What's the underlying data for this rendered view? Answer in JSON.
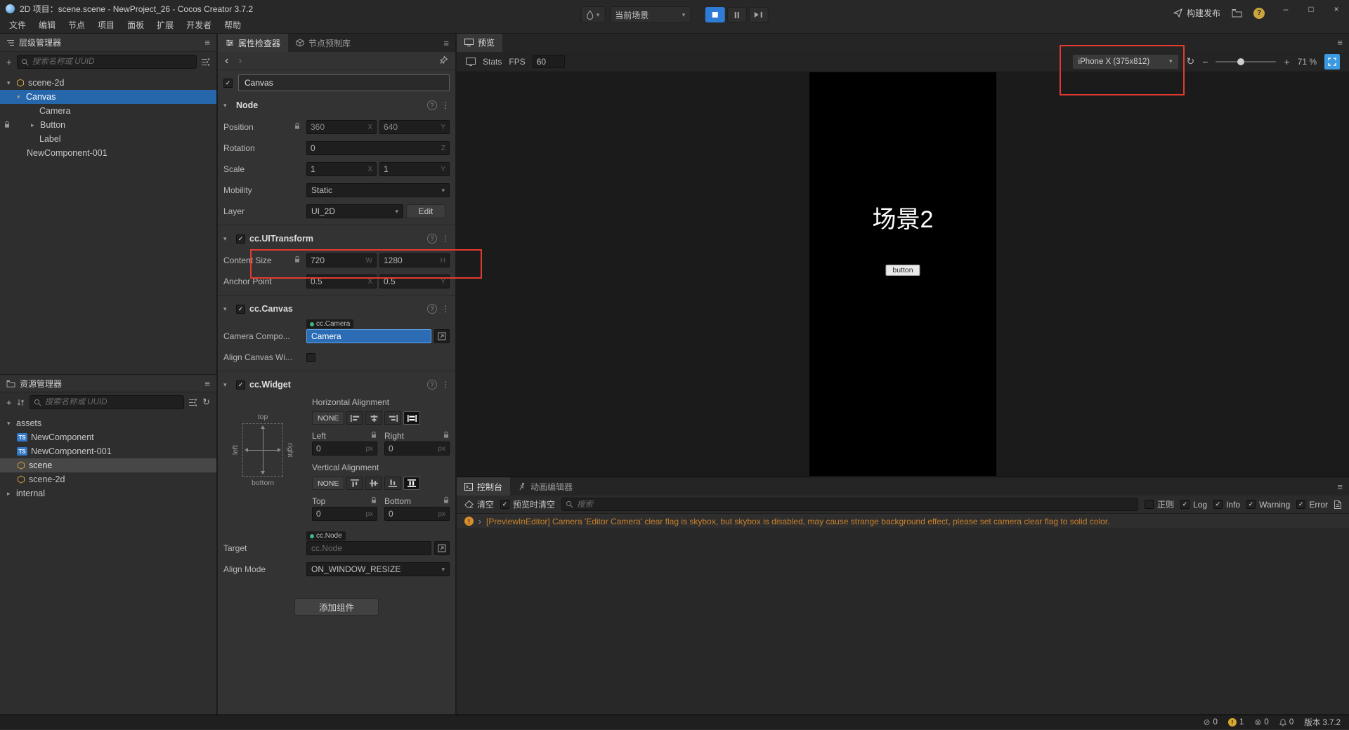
{
  "titlebar": {
    "title": "2D 项目：scene.scene - NewProject_26 - Cocos Creator 3.7.2",
    "menus": [
      "文件",
      "编辑",
      "节点",
      "项目",
      "面板",
      "扩展",
      "开发者",
      "帮助"
    ],
    "scene_selector": "当前场景",
    "build_button": "构建发布"
  },
  "hierarchy": {
    "title": "层级管理器",
    "search_placeholder": "搜索名称或 UUID",
    "nodes": [
      {
        "label": "scene-2d"
      },
      {
        "label": "Canvas"
      },
      {
        "label": "Camera"
      },
      {
        "label": "Button"
      },
      {
        "label": "Label"
      },
      {
        "label": "NewComponent-001"
      }
    ]
  },
  "assets": {
    "title": "资源管理器",
    "search_placeholder": "搜索名称或 UUID",
    "items": [
      {
        "label": "assets"
      },
      {
        "label": "NewComponent",
        "badge": "TS"
      },
      {
        "label": "NewComponent-001",
        "badge": "TS"
      },
      {
        "label": "scene"
      },
      {
        "label": "scene-2d"
      },
      {
        "label": "internal"
      }
    ]
  },
  "inspector": {
    "tabs": {
      "inspector": "属性检查器",
      "prefab": "节点预制库"
    },
    "node_name": "Canvas",
    "units": {
      "x": "X",
      "y": "Y",
      "z": "Z",
      "w": "W",
      "h": "H",
      "px": "px"
    },
    "node": {
      "title": "Node",
      "position_label": "Position",
      "position_x": "360",
      "position_y": "640",
      "rotation_label": "Rotation",
      "rotation_z": "0",
      "scale_label": "Scale",
      "scale_x": "1",
      "scale_y": "1",
      "mobility_label": "Mobility",
      "mobility_value": "Static",
      "layer_label": "Layer",
      "layer_value": "UI_2D",
      "edit_button": "Edit"
    },
    "uitransform": {
      "title": "cc.UITransform",
      "content_size_label": "Content Size",
      "width": "720",
      "height": "1280",
      "anchor_label": "Anchor Point",
      "anchor_x": "0.5",
      "anchor_y": "0.5"
    },
    "canvas_comp": {
      "title": "cc.Canvas",
      "camera_label": "Camera Compo...",
      "camera_badge": "cc.Camera",
      "camera_value": "Camera",
      "align_label": "Align Canvas Wi..."
    },
    "widget": {
      "title": "cc.Widget",
      "h_align_label": "Horizontal Alignment",
      "v_align_label": "Vertical Alignment",
      "none": "NONE",
      "left_label": "Left",
      "right_label": "Right",
      "top_label": "Top",
      "bottom_label": "Bottom",
      "left_value": "0",
      "right_value": "0",
      "top_value": "0",
      "bottom_value": "0",
      "diagram": {
        "top": "top",
        "bottom": "bottom",
        "left": "left",
        "right": "right"
      },
      "target_label": "Target",
      "target_badge": "cc.Node",
      "target_placeholder": "cc.Node",
      "align_mode_label": "Align Mode",
      "align_mode_value": "ON_WINDOW_RESIZE"
    },
    "add_component": "添加组件"
  },
  "preview": {
    "tab": "预览",
    "stats": "Stats",
    "fps_label": "FPS",
    "fps_value": "60",
    "device": "iPhone X (375x812)",
    "zoom": "71 %",
    "scene_title": "场景2",
    "button_label": "button"
  },
  "console": {
    "tab_console": "控制台",
    "tab_animation": "动画编辑器",
    "clear": "清空",
    "clear_on_preview": "预览时清空",
    "search_placeholder": "搜索",
    "regex": "正则",
    "filters": [
      {
        "label": "Log"
      },
      {
        "label": "Info"
      },
      {
        "label": "Warning"
      },
      {
        "label": "Error"
      }
    ],
    "message": "[PreviewInEditor] Camera 'Editor Camera' clear flag is skybox, but skybox is disabled, may cause strange background effect, please set camera clear flag to solid color."
  },
  "statusbar": {
    "muted_count": "0",
    "warning_count": "1",
    "error_count": "0",
    "notification_count": "0",
    "version": "版本 3.7.2"
  },
  "colors": {
    "selection_blue": "#2667ac",
    "accent_blue": "#3c9ae2",
    "annotation_red": "#e13b30",
    "warning_orange": "#c8802b"
  }
}
